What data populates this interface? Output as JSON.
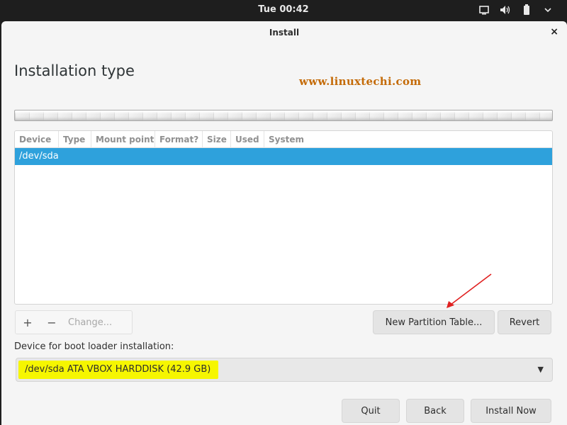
{
  "topbar": {
    "clock": "Tue 00:42",
    "icons": [
      "display-icon",
      "volume-icon",
      "battery-icon",
      "power-menu-icon"
    ]
  },
  "window": {
    "title": "Install",
    "close_label": "×"
  },
  "page": {
    "heading": "Installation type",
    "watermark": "www.linuxtechi.com"
  },
  "table": {
    "columns": [
      "Device",
      "Type",
      "Mount point",
      "Format?",
      "Size",
      "Used",
      "System"
    ],
    "rows": [
      {
        "device": "/dev/sda"
      }
    ],
    "selected_row_color": "#2ea1dc"
  },
  "toolbar": {
    "add": "+",
    "remove": "−",
    "change": "Change..."
  },
  "buttons": {
    "new_partition_table": "New Partition Table...",
    "revert": "Revert",
    "quit": "Quit",
    "back": "Back",
    "install_now": "Install Now"
  },
  "boot": {
    "label": "Device for boot loader installation:",
    "selected": "/dev/sda ATA VBOX HARDDISK (42.9 GB)",
    "highlight_color": "#f6f600"
  },
  "annotation": {
    "arrow_color": "#e02020"
  },
  "colors": {
    "watermark": "#c46b08"
  }
}
